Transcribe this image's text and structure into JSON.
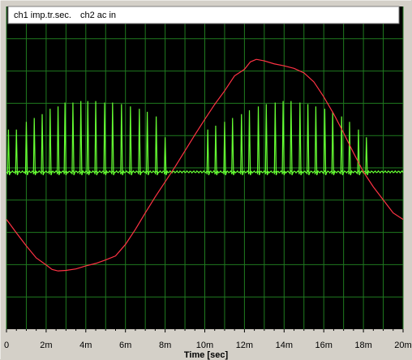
{
  "chart_data": {
    "type": "line",
    "title": "",
    "xlabel": "Time [sec]",
    "ylabel": "",
    "xlim": [
      0,
      20
    ],
    "x_unit": "ms",
    "x_ticks": [
      0,
      2,
      4,
      6,
      8,
      10,
      12,
      14,
      16,
      18,
      20
    ],
    "x_tick_labels": [
      "0",
      "2m",
      "4m",
      "6m",
      "8m",
      "10m",
      "12m",
      "14m",
      "16m",
      "18m",
      "20m"
    ],
    "grid": true,
    "background": "#000000",
    "grid_color": "#1f7a1f",
    "legend_position": "top-left",
    "series": [
      {
        "name": "ch1 imp.tr.sec.",
        "color": "#66ff33",
        "baseline": 0.0,
        "pulse_times_ms": [
          0.1,
          0.5,
          1.0,
          1.4,
          1.8,
          2.2,
          2.6,
          2.95,
          3.35,
          3.75,
          4.1,
          4.5,
          4.95,
          5.35,
          5.8,
          6.25,
          6.7,
          7.1,
          7.55,
          8.0,
          10.15,
          10.55,
          11.0,
          11.4,
          11.85,
          12.25,
          12.7,
          13.1,
          13.55,
          13.95,
          14.35,
          14.8,
          15.2,
          15.6,
          16.05,
          16.45,
          16.9,
          17.3,
          17.75,
          18.15
        ],
        "pulse_heights": [
          0.55,
          0.55,
          0.65,
          0.7,
          0.75,
          0.82,
          0.85,
          0.9,
          0.9,
          0.92,
          0.92,
          0.92,
          0.9,
          0.9,
          0.88,
          0.85,
          0.82,
          0.78,
          0.72,
          0.45,
          0.55,
          0.6,
          0.65,
          0.7,
          0.75,
          0.8,
          0.85,
          0.88,
          0.9,
          0.92,
          0.92,
          0.9,
          0.88,
          0.85,
          0.82,
          0.78,
          0.72,
          0.65,
          0.55,
          0.45
        ]
      },
      {
        "name": "ch2 ac in",
        "color": "#ff3344",
        "x": [
          0,
          0.5,
          1.0,
          1.5,
          2.0,
          2.3,
          2.6,
          3.0,
          3.5,
          4.0,
          4.5,
          5.0,
          5.5,
          6.0,
          6.5,
          7.0,
          7.5,
          8.0,
          8.5,
          9.0,
          9.5,
          10.0,
          10.5,
          11.0,
          11.5,
          12.0,
          12.3,
          12.6,
          13.0,
          13.5,
          14.0,
          14.5,
          15.0,
          15.5,
          16.0,
          16.5,
          17.0,
          17.5,
          18.0,
          18.5,
          19.0,
          19.5,
          20.0
        ],
        "y": [
          -0.95,
          -1.22,
          -1.48,
          -1.72,
          -1.86,
          -1.95,
          -1.98,
          -1.97,
          -1.94,
          -1.88,
          -1.83,
          -1.76,
          -1.68,
          -1.45,
          -1.15,
          -0.82,
          -0.5,
          -0.2,
          0.1,
          0.42,
          0.74,
          1.05,
          1.35,
          1.62,
          1.92,
          2.05,
          2.2,
          2.25,
          2.22,
          2.16,
          2.12,
          2.07,
          1.98,
          1.8,
          1.5,
          1.16,
          0.78,
          0.38,
          0.0,
          -0.3,
          -0.56,
          -0.82,
          -0.95
        ]
      }
    ]
  }
}
